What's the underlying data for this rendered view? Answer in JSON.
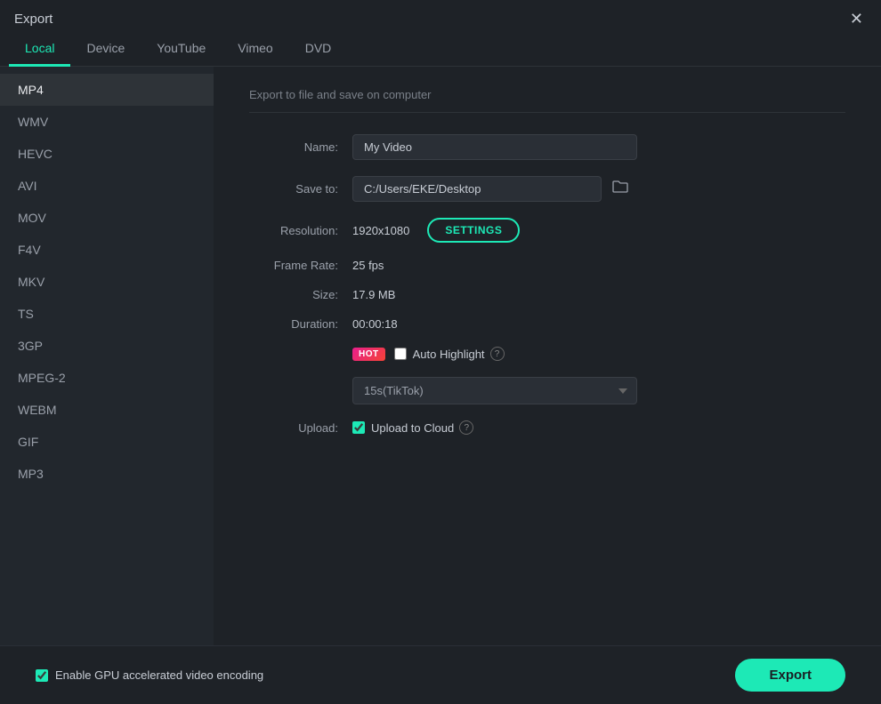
{
  "titleBar": {
    "title": "Export",
    "closeLabel": "✕"
  },
  "tabs": [
    {
      "id": "local",
      "label": "Local",
      "active": true
    },
    {
      "id": "device",
      "label": "Device",
      "active": false
    },
    {
      "id": "youtube",
      "label": "YouTube",
      "active": false
    },
    {
      "id": "vimeo",
      "label": "Vimeo",
      "active": false
    },
    {
      "id": "dvd",
      "label": "DVD",
      "active": false
    }
  ],
  "sidebar": {
    "items": [
      {
        "id": "mp4",
        "label": "MP4",
        "active": true
      },
      {
        "id": "wmv",
        "label": "WMV",
        "active": false
      },
      {
        "id": "hevc",
        "label": "HEVC",
        "active": false
      },
      {
        "id": "avi",
        "label": "AVI",
        "active": false
      },
      {
        "id": "mov",
        "label": "MOV",
        "active": false
      },
      {
        "id": "f4v",
        "label": "F4V",
        "active": false
      },
      {
        "id": "mkv",
        "label": "MKV",
        "active": false
      },
      {
        "id": "ts",
        "label": "TS",
        "active": false
      },
      {
        "id": "3gp",
        "label": "3GP",
        "active": false
      },
      {
        "id": "mpeg2",
        "label": "MPEG-2",
        "active": false
      },
      {
        "id": "webm",
        "label": "WEBM",
        "active": false
      },
      {
        "id": "gif",
        "label": "GIF",
        "active": false
      },
      {
        "id": "mp3",
        "label": "MP3",
        "active": false
      }
    ]
  },
  "panel": {
    "description": "Export to file and save on computer",
    "fields": {
      "name": {
        "label": "Name:",
        "value": "My Video",
        "placeholder": "My Video"
      },
      "saveTo": {
        "label": "Save to:",
        "value": "C:/Users/EKE/Desktop",
        "folderIcon": "📁"
      },
      "resolution": {
        "label": "Resolution:",
        "value": "1920x1080",
        "settingsLabel": "SETTINGS"
      },
      "frameRate": {
        "label": "Frame Rate:",
        "value": "25 fps"
      },
      "size": {
        "label": "Size:",
        "value": "17.9 MB"
      },
      "duration": {
        "label": "Duration:",
        "value": "00:00:18"
      },
      "autoHighlight": {
        "label": "Auto Highlight",
        "hotBadge": "HOT",
        "checked": false,
        "helpTitle": "?"
      },
      "highlightDropdown": {
        "options": [
          {
            "value": "15s-tiktok",
            "label": "15s(TikTok)"
          }
        ],
        "selected": "15s(TikTok)"
      },
      "upload": {
        "label": "Upload:",
        "checkboxLabel": "Upload to Cloud",
        "checked": true,
        "helpTitle": "?"
      }
    }
  },
  "footer": {
    "gpuLabel": "Enable GPU accelerated video encoding",
    "exportLabel": "Export"
  }
}
